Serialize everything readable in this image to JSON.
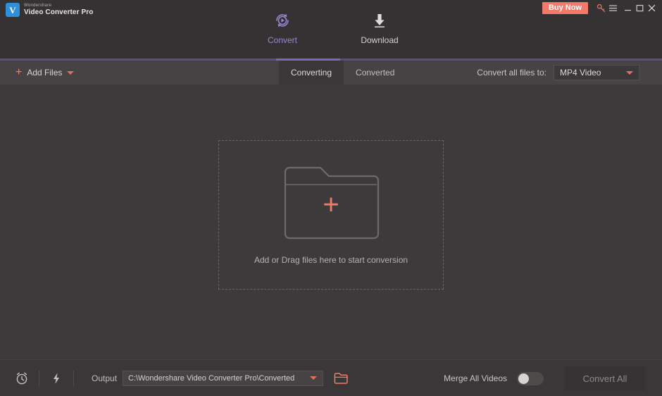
{
  "window": {
    "logo_brand": "Wondershare",
    "logo_product": "Video Converter Pro",
    "logo_mark": "V",
    "buy_now": "Buy Now",
    "icons": {
      "key": "key-icon",
      "menu": "hamburger-menu-icon",
      "minimize": "minimize-icon",
      "maximize": "maximize-icon",
      "close": "close-icon"
    },
    "accent_purple": "#8065b8",
    "accent_coral": "#ef7c68",
    "buy_now_bg": "#f4796a",
    "bg": "#3d3a3b"
  },
  "nav": {
    "tabs": [
      {
        "label": "Convert",
        "icon": "convert-rotate-play-icon",
        "active": true
      },
      {
        "label": "Download",
        "icon": "download-arrow-icon",
        "active": false
      }
    ]
  },
  "toolbar": {
    "add_files_label": "Add Files",
    "add_files_icon": "plus-icon",
    "add_files_caret": "chevron-down-icon",
    "segments": [
      {
        "label": "Converting",
        "active": true
      },
      {
        "label": "Converted",
        "active": false
      }
    ],
    "convert_all_to_label": "Convert all files to:",
    "format_value": "MP4 Video",
    "format_caret": "chevron-down-icon"
  },
  "main": {
    "dropzone_text": "Add or Drag files here to start conversion",
    "dropzone_icon": "folder-add-icon",
    "dropzone_plus": "+"
  },
  "footer": {
    "timer_icon": "alarm-clock-icon",
    "speed_icon": "lightning-bolt-icon",
    "output_label": "Output",
    "output_path": "C:\\Wondershare Video Converter Pro\\Converted",
    "output_caret": "chevron-down-icon",
    "browse_icon": "open-folder-icon",
    "merge_label": "Merge All Videos",
    "merge_enabled": false,
    "convert_all_label": "Convert All",
    "convert_all_disabled": true
  }
}
